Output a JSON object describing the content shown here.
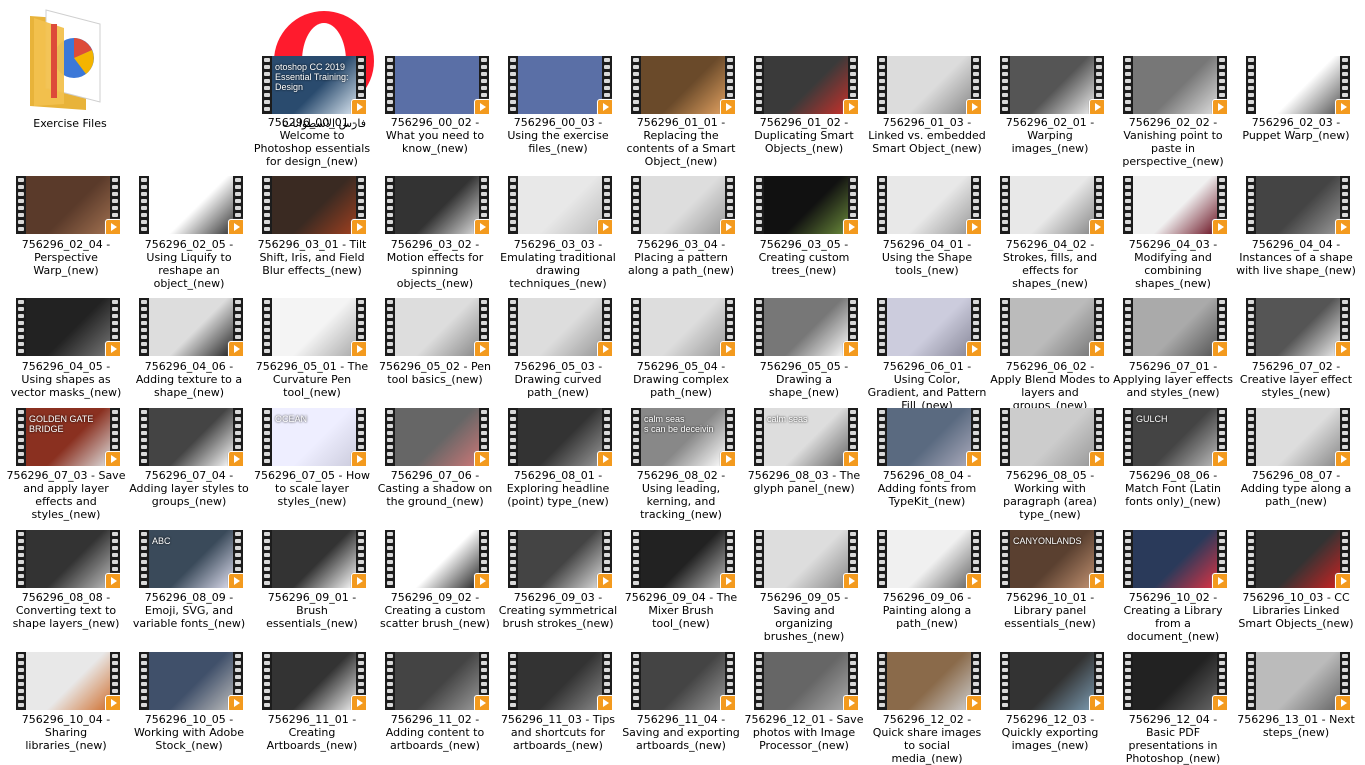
{
  "window": {
    "title": "Exercise Files folder view"
  },
  "desktop_icons": [
    {
      "label": "Exercise Files",
      "icon": "folder-icon"
    },
    {
      "label": "فارس الاسطوانات",
      "icon": "opera-shortcut-icon"
    }
  ],
  "colors": {
    "play_badge": "#f39a1e",
    "film_strip": "#1c1c1c",
    "background": "#ffffff"
  },
  "videos": [
    {
      "label": "756296_00_01 - Welcome to Photoshop essentials for design_(new)",
      "thumb_text": "otoshop CC 2019 Essential Training: Design"
    },
    {
      "label": "756296_00_02 - What you need to know_(new)"
    },
    {
      "label": "756296_00_03 - Using the exercise files_(new)"
    },
    {
      "label": "756296_01_01 - Replacing the contents of a Smart Object_(new)"
    },
    {
      "label": "756296_01_02 - Duplicating Smart Objects_(new)"
    },
    {
      "label": "756296_01_03 - Linked vs. embedded Smart Object_(new)"
    },
    {
      "label": "756296_02_01 - Warping images_(new)"
    },
    {
      "label": "756296_02_02 - Vanishing point to paste in perspective_(new)"
    },
    {
      "label": "756296_02_03 - Puppet Warp_(new)"
    },
    {
      "label": "756296_02_04 - Perspective Warp_(new)"
    },
    {
      "label": "756296_02_05 - Using Liquify to reshape an object_(new)"
    },
    {
      "label": "756296_03_01 - Tilt Shift, Iris, and Field Blur effects_(new)"
    },
    {
      "label": "756296_03_02 - Motion effects for spinning objects_(new)"
    },
    {
      "label": "756296_03_03 - Emulating traditional drawing techniques_(new)"
    },
    {
      "label": "756296_03_04 - Placing a pattern along a path_(new)"
    },
    {
      "label": "756296_03_05 - Creating custom trees_(new)"
    },
    {
      "label": "756296_04_01 - Using the Shape tools_(new)"
    },
    {
      "label": "756296_04_02 - Strokes, fills, and effects for shapes_(new)"
    },
    {
      "label": "756296_04_03 - Modifying and combining shapes_(new)"
    },
    {
      "label": "756296_04_04 - Instances of a shape with live shape_(new)"
    },
    {
      "label": "756296_04_05 - Using shapes as vector masks_(new)"
    },
    {
      "label": "756296_04_06 - Adding texture to a shape_(new)"
    },
    {
      "label": "756296_05_01 - The Curvature Pen tool_(new)"
    },
    {
      "label": "756296_05_02 - Pen tool basics_(new)"
    },
    {
      "label": "756296_05_03 - Drawing curved path_(new)"
    },
    {
      "label": "756296_05_04 - Drawing complex path_(new)"
    },
    {
      "label": "756296_05_05 - Drawing a shape_(new)"
    },
    {
      "label": "756296_06_01 - Using Color, Gradient, and Pattern Fill_(new)"
    },
    {
      "label": "756296_06_02 - Apply Blend Modes to layers and groups_(new)"
    },
    {
      "label": "756296_07_01 - Applying layer effects and styles_(new)"
    },
    {
      "label": "756296_07_02 - Creative layer effect styles_(new)"
    },
    {
      "label": "756296_07_03 - Save and apply layer effects and styles_(new)",
      "thumb_text": "GOLDEN GATE BRIDGE"
    },
    {
      "label": "756296_07_04 - Adding layer styles to groups_(new)"
    },
    {
      "label": "756296_07_05 - How to scale layer styles_(new)",
      "thumb_text": "OCEAN"
    },
    {
      "label": "756296_07_06 - Casting a shadow on the ground_(new)"
    },
    {
      "label": "756296_08_01 - Exploring headline (point) type_(new)"
    },
    {
      "label": "756296_08_02 - Using leading, kerning, and tracking_(new)",
      "thumb_text": "calm seas\ns can be deceivin"
    },
    {
      "label": "756296_08_03 - The glyph panel_(new)",
      "thumb_text": "calm seas"
    },
    {
      "label": "756296_08_04 - Adding fonts from TypeKit_(new)"
    },
    {
      "label": "756296_08_05 - Working with paragraph (area) type_(new)"
    },
    {
      "label": "756296_08_06 - Match Font (Latin fonts only)_(new)",
      "thumb_text": "GULCH"
    },
    {
      "label": "756296_08_07 - Adding type along a path_(new)"
    },
    {
      "label": "756296_08_08 - Converting text to shape layers_(new)"
    },
    {
      "label": "756296_08_09 - Emoji, SVG, and variable fonts_(new)",
      "thumb_text": "ABC"
    },
    {
      "label": "756296_09_01 - Brush essentials_(new)"
    },
    {
      "label": "756296_09_02 - Creating a custom scatter brush_(new)"
    },
    {
      "label": "756296_09_03 - Creating symmetrical brush strokes_(new)"
    },
    {
      "label": "756296_09_04 - The Mixer Brush tool_(new)"
    },
    {
      "label": "756296_09_05 - Saving and organizing brushes_(new)"
    },
    {
      "label": "756296_09_06 - Painting along a path_(new)"
    },
    {
      "label": "756296_10_01 - Library panel essentials_(new)",
      "thumb_text": "CANYONLANDS"
    },
    {
      "label": "756296_10_02 - Creating a Library from a document_(new)"
    },
    {
      "label": "756296_10_03 - CC Libraries Linked Smart Objects_(new)"
    },
    {
      "label": "756296_10_04 - Sharing libraries_(new)"
    },
    {
      "label": "756296_10_05 - Working with Adobe Stock_(new)"
    },
    {
      "label": "756296_11_01 - Creating Artboards_(new)"
    },
    {
      "label": "756296_11_02 - Adding content to artboards_(new)"
    },
    {
      "label": "756296_11_03 - Tips and shortcuts for artboards_(new)"
    },
    {
      "label": "756296_11_04 - Saving and exporting artboards_(new)"
    },
    {
      "label": "756296_12_01 - Save photos with Image Processor_(new)"
    },
    {
      "label": "756296_12_02 - Quick share images to social media_(new)"
    },
    {
      "label": "756296_12_03 - Quickly exporting images_(new)"
    },
    {
      "label": "756296_12_04 - Basic PDF presentations in Photoshop_(new)"
    },
    {
      "label": "756296_13_01 - Next steps_(new)"
    }
  ]
}
